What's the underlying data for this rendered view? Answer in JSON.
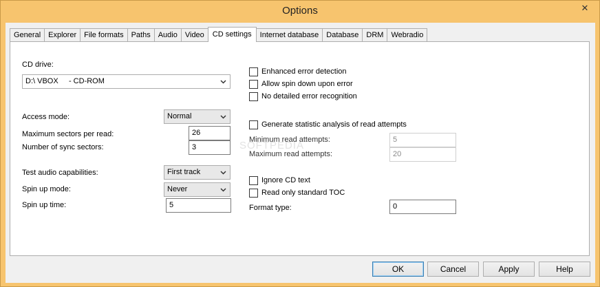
{
  "window": {
    "title": "Options",
    "close_glyph": "✕"
  },
  "tabs": [
    "General",
    "Explorer",
    "File formats",
    "Paths",
    "Audio",
    "Video",
    "CD settings",
    "Internet database",
    "Database",
    "DRM",
    "Webradio"
  ],
  "active_tab": "CD settings",
  "left": {
    "cd_drive_label": "CD drive:",
    "cd_drive_value": "D:\\ VBOX     - CD-ROM",
    "access_mode_label": "Access mode:",
    "access_mode_value": "Normal",
    "max_sectors_label": "Maximum sectors per read:",
    "max_sectors_value": "26",
    "sync_sectors_label": "Number of sync sectors:",
    "sync_sectors_value": "3",
    "test_audio_label": "Test audio capabilities:",
    "test_audio_value": "First track",
    "spin_up_mode_label": "Spin up mode:",
    "spin_up_mode_value": "Never",
    "spin_up_time_label": "Spin up time:",
    "spin_up_time_value": "5"
  },
  "right": {
    "enhanced_error": "Enhanced error detection",
    "allow_spin_down": "Allow spin down upon error",
    "no_detailed_error": "No detailed error recognition",
    "generate_statistic": "Generate statistic analysis of read attempts",
    "min_read_label": "Minimum read attempts:",
    "min_read_value": "5",
    "max_read_label": "Maximum read attempts:",
    "max_read_value": "20",
    "ignore_cd_text": "Ignore CD text",
    "read_only_toc": "Read only standard TOC",
    "format_type_label": "Format type:",
    "format_type_value": "0"
  },
  "buttons": {
    "ok": "OK",
    "cancel": "Cancel",
    "apply": "Apply",
    "help": "Help"
  },
  "watermark": "SOFTPEDIA"
}
